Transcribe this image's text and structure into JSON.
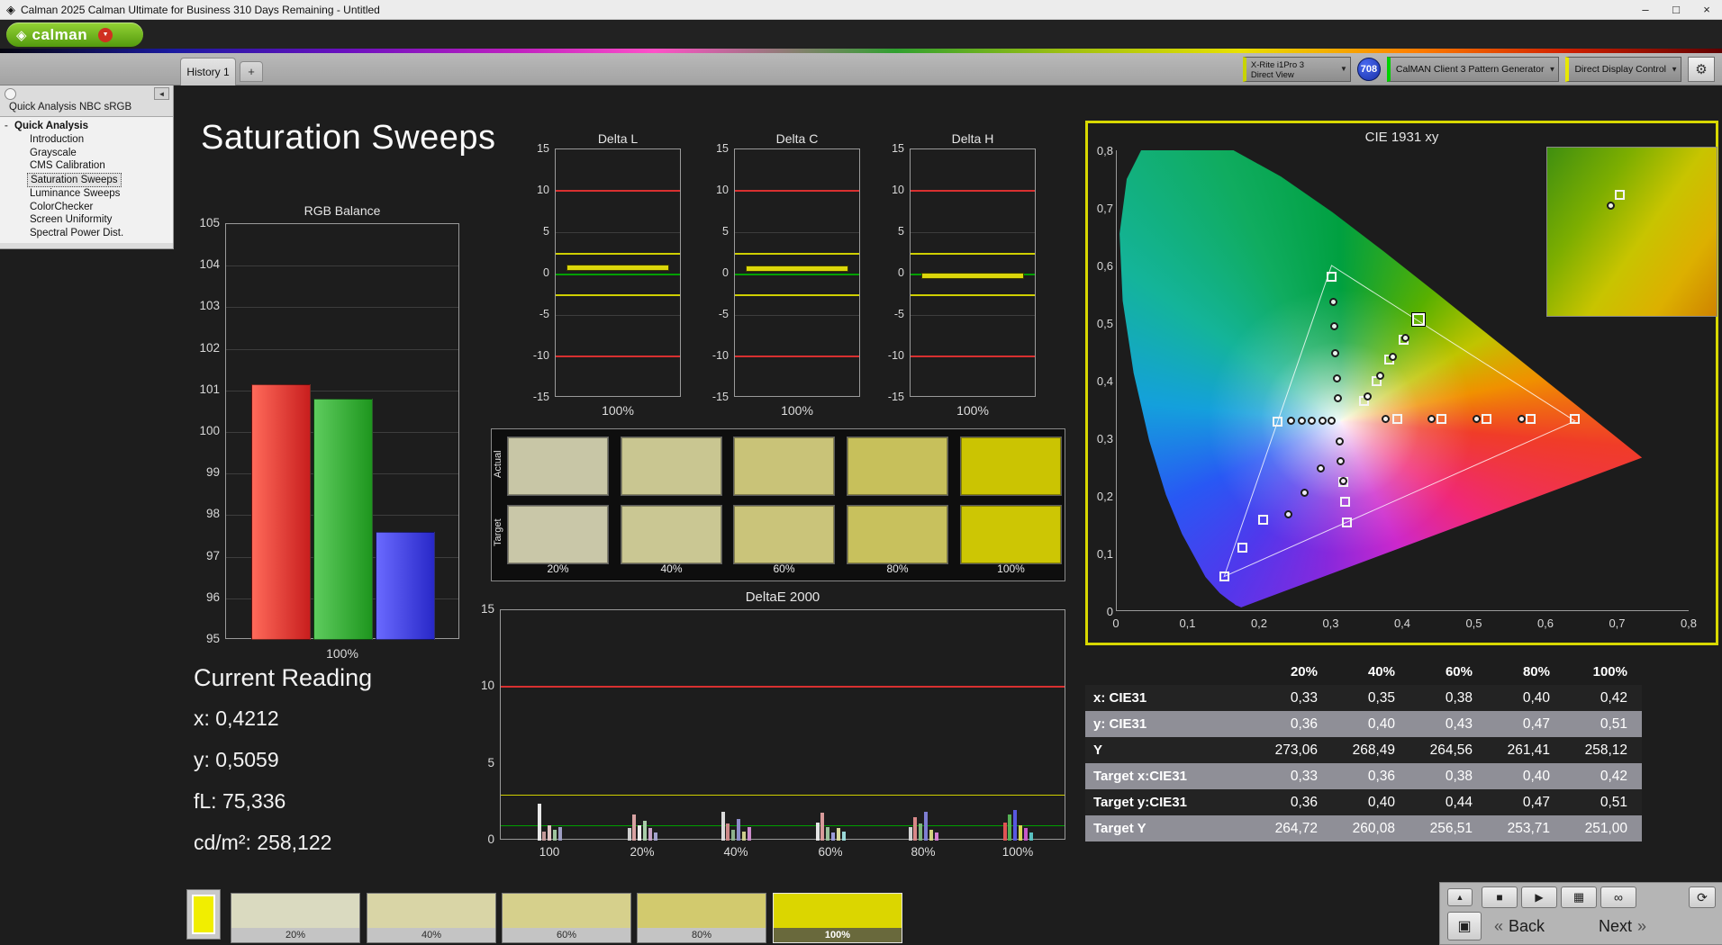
{
  "title_bar": {
    "title": "Calman 2025 Calman Ultimate for Business 310 Days Remaining  - Untitled"
  },
  "window": {
    "minimize": "–",
    "maximize": "□",
    "close": "×"
  },
  "logo": {
    "brand": "calman"
  },
  "tabs": {
    "history": "History 1",
    "add": "+"
  },
  "devices": {
    "meter": {
      "line1": "X-Rite i1Pro 3",
      "line2": "Direct View",
      "accent": "#c8d400"
    },
    "badge": "708",
    "pattern": {
      "label": "CalMAN Client 3 Pattern Generator",
      "accent": "#00d000"
    },
    "display": {
      "label": "Direct Display Control",
      "accent": "#e8e800"
    }
  },
  "icons": {
    "app": "◈",
    "brand_diamond": "◈",
    "caret_down": "▼",
    "gear": "⚙",
    "collapse_left": "◄",
    "eject": "▲",
    "stop": "■",
    "play": "▶",
    "save": "▦",
    "loop": "∞",
    "refresh": "⟳",
    "pattern_window": "▣"
  },
  "sidebar": {
    "header": "Quick Analysis NBC sRGB",
    "root": "Quick Analysis",
    "items": [
      {
        "label": "Introduction"
      },
      {
        "label": "Grayscale"
      },
      {
        "label": "CMS Calibration"
      },
      {
        "label": "Saturation Sweeps",
        "selected": true
      },
      {
        "label": "Luminance Sweeps"
      },
      {
        "label": "ColorChecker"
      },
      {
        "label": "Screen Uniformity"
      },
      {
        "label": "Spectral Power Dist."
      }
    ]
  },
  "page": {
    "title": "Saturation Sweeps"
  },
  "current_reading": {
    "heading": "Current Reading",
    "x": "x: 0,4212",
    "y": "y: 0,5059",
    "fl": "fL: 75,336",
    "cdm2": "cd/m²: 258,122"
  },
  "chart_data": [
    {
      "id": "rgb-balance",
      "type": "bar",
      "title": "RGB Balance",
      "categories": [
        "Red",
        "Green",
        "Blue"
      ],
      "values": [
        101.15,
        100.8,
        97.6
      ],
      "colors": [
        [
          "#ff6a5a",
          "#c81e1e"
        ],
        [
          "#5ecc5e",
          "#1e961e"
        ],
        [
          "#6a6aff",
          "#2828c8"
        ]
      ],
      "ylim": [
        95,
        105
      ],
      "ytick_step": 1,
      "xlabel": "100%",
      "grid": true
    },
    {
      "id": "delta-l",
      "type": "tolerance-bar",
      "title": "Delta L",
      "value": 0.6,
      "ylim": [
        -15,
        15
      ],
      "yticks": [
        15,
        10,
        5,
        0,
        -5,
        -10,
        -15
      ],
      "red_lines": [
        10,
        -10
      ],
      "yellow_lines": [
        2.5,
        -2.5
      ],
      "green_lines": [
        0
      ],
      "bar_color": "#dcd70a",
      "xlabel": "100%"
    },
    {
      "id": "delta-c",
      "type": "tolerance-bar",
      "title": "Delta C",
      "value": 0.5,
      "ylim": [
        -15,
        15
      ],
      "yticks": [
        15,
        10,
        5,
        0,
        -5,
        -10,
        -15
      ],
      "red_lines": [
        10,
        -10
      ],
      "yellow_lines": [
        2.5,
        -2.5
      ],
      "green_lines": [
        0
      ],
      "bar_color": "#dcd70a",
      "xlabel": "100%"
    },
    {
      "id": "delta-h",
      "type": "tolerance-bar",
      "title": "Delta H",
      "value": -0.3,
      "ylim": [
        -15,
        15
      ],
      "yticks": [
        15,
        10,
        5,
        0,
        -5,
        -10,
        -15
      ],
      "red_lines": [
        10,
        -10
      ],
      "yellow_lines": [
        2.5,
        -2.5
      ],
      "green_lines": [
        0
      ],
      "bar_color": "#dcd70a",
      "xlabel": "100%"
    },
    {
      "id": "deltae-2000",
      "type": "grouped-bar",
      "title": "DeltaE 2000",
      "ylim": [
        0,
        15
      ],
      "yticks": [
        0,
        5,
        10,
        15
      ],
      "red_lines": [
        10
      ],
      "yellow_lines": [
        3
      ],
      "green_lines": [
        1
      ],
      "group_labels": [
        "100",
        "20%",
        "40%",
        "60%",
        "80%",
        "100%"
      ],
      "group_x": [
        55,
        158,
        262,
        367,
        470,
        575
      ],
      "groups": [
        [
          [
            "#e9e9e9",
            2.4
          ],
          [
            "#c49a9a",
            0.6
          ],
          [
            "#e0c4c4",
            1.0
          ],
          [
            "#9ec49e",
            0.7
          ],
          [
            "#9e9ec4",
            0.9
          ]
        ],
        [
          [
            "#cfcfcf",
            0.8
          ],
          [
            "#d8a2a2",
            1.7
          ],
          [
            "#ececec",
            1.0
          ],
          [
            "#a8cca8",
            1.3
          ],
          [
            "#c6a2c6",
            0.8
          ],
          [
            "#a2a2cc",
            0.5
          ]
        ],
        [
          [
            "#dadada",
            1.9
          ],
          [
            "#cc8888",
            1.1
          ],
          [
            "#8cb08c",
            0.7
          ],
          [
            "#8c8cc8",
            1.4
          ],
          [
            "#cccc8c",
            0.6
          ],
          [
            "#cc8ccc",
            0.9
          ]
        ],
        [
          [
            "#e4e4e4",
            1.2
          ],
          [
            "#d89a9a",
            1.8
          ],
          [
            "#9ac09a",
            0.9
          ],
          [
            "#9a9ad8",
            0.5
          ],
          [
            "#d8d89a",
            0.8
          ],
          [
            "#9ad8d8",
            0.6
          ]
        ],
        [
          [
            "#d2d2d2",
            0.9
          ],
          [
            "#d88888",
            1.5
          ],
          [
            "#7eb47e",
            1.1
          ],
          [
            "#7e7ed2",
            1.9
          ],
          [
            "#d2d27e",
            0.7
          ],
          [
            "#d27ed2",
            0.5
          ]
        ],
        [
          [
            "#e05454",
            1.2
          ],
          [
            "#54b054",
            1.7
          ],
          [
            "#5858e0",
            2.0
          ],
          [
            "#d8d854",
            1.0
          ],
          [
            "#c858c8",
            0.8
          ],
          [
            "#58c0c0",
            0.5
          ]
        ]
      ]
    },
    {
      "id": "cie-1931",
      "type": "scatter",
      "title": "CIE 1931 xy",
      "xlim": [
        0,
        0.8
      ],
      "ylim": [
        0,
        0.8
      ],
      "xticks": [
        "0",
        "0,1",
        "0,2",
        "0,3",
        "0,4",
        "0,5",
        "0,6",
        "0,7",
        "0,8"
      ],
      "yticks": [
        "0",
        "0,1",
        "0,2",
        "0,3",
        "0,4",
        "0,5",
        "0,6",
        "0,7",
        "0,8"
      ],
      "srgb_triangle": [
        [
          0.64,
          0.33
        ],
        [
          0.3,
          0.6
        ],
        [
          0.15,
          0.06
        ]
      ],
      "white_point": [
        0.3127,
        0.329
      ],
      "targets": [
        [
          0.392,
          0.333
        ],
        [
          0.454,
          0.333
        ],
        [
          0.516,
          0.333
        ],
        [
          0.578,
          0.333
        ],
        [
          0.64,
          0.333
        ],
        [
          0.3,
          0.581
        ],
        [
          0.345,
          0.365
        ],
        [
          0.363,
          0.4
        ],
        [
          0.381,
          0.436
        ],
        [
          0.4,
          0.471
        ],
        [
          0.225,
          0.329
        ],
        [
          0.204,
          0.159
        ],
        [
          0.175,
          0.11
        ],
        [
          0.15,
          0.06
        ],
        [
          0.316,
          0.225
        ],
        [
          0.319,
          0.19
        ],
        [
          0.321,
          0.154
        ]
      ],
      "measurements": [
        [
          0.303,
          0.537
        ],
        [
          0.304,
          0.494
        ],
        [
          0.305,
          0.448
        ],
        [
          0.307,
          0.404
        ],
        [
          0.309,
          0.37
        ],
        [
          0.376,
          0.334
        ],
        [
          0.44,
          0.334
        ],
        [
          0.502,
          0.334
        ],
        [
          0.565,
          0.334
        ],
        [
          0.243,
          0.33
        ],
        [
          0.258,
          0.33
        ],
        [
          0.272,
          0.33
        ],
        [
          0.287,
          0.33
        ],
        [
          0.3,
          0.33
        ],
        [
          0.35,
          0.372
        ],
        [
          0.368,
          0.408
        ],
        [
          0.386,
          0.442
        ],
        [
          0.403,
          0.474
        ],
        [
          0.311,
          0.295
        ],
        [
          0.313,
          0.26
        ],
        [
          0.316,
          0.226
        ],
        [
          0.285,
          0.247
        ],
        [
          0.262,
          0.205
        ],
        [
          0.24,
          0.168
        ]
      ],
      "current": [
        0.4212,
        0.5059
      ]
    }
  ],
  "patch_panel": {
    "row_labels": [
      "Actual",
      "Target"
    ],
    "col_labels": [
      "20%",
      "40%",
      "60%",
      "80%",
      "100%"
    ],
    "actual": [
      "#c8c6a6",
      "#c9c691",
      "#c9c378",
      "#c7c05b",
      "#cbc402"
    ],
    "target": [
      "#c9c7a8",
      "#cac793",
      "#cac47a",
      "#c8c15d",
      "#cdc604"
    ]
  },
  "table": {
    "headers": [
      "",
      "20%",
      "40%",
      "60%",
      "80%",
      "100%"
    ],
    "rows": [
      {
        "label": "x: CIE31",
        "values": [
          "0,33",
          "0,35",
          "0,38",
          "0,40",
          "0,42"
        ],
        "shade": "dark"
      },
      {
        "label": "y: CIE31",
        "values": [
          "0,36",
          "0,40",
          "0,43",
          "0,47",
          "0,51"
        ],
        "shade": "gray"
      },
      {
        "label": "Y",
        "values": [
          "273,06",
          "268,49",
          "264,56",
          "261,41",
          "258,12"
        ],
        "shade": "dark"
      },
      {
        "label": "Target x:CIE31",
        "values": [
          "0,33",
          "0,36",
          "0,38",
          "0,40",
          "0,42"
        ],
        "shade": "gray"
      },
      {
        "label": "Target y:CIE31",
        "values": [
          "0,36",
          "0,40",
          "0,44",
          "0,47",
          "0,51"
        ],
        "shade": "dark"
      },
      {
        "label": "Target Y",
        "values": [
          "264,72",
          "260,08",
          "256,51",
          "253,71",
          "251,00"
        ],
        "shade": "gray"
      }
    ]
  },
  "bottom_bar": {
    "swatch_color": "#f1ee00",
    "patches": [
      {
        "label": "20%",
        "color": "#dadac0"
      },
      {
        "label": "40%",
        "color": "#d9d5a6"
      },
      {
        "label": "60%",
        "color": "#d6d08c"
      },
      {
        "label": "80%",
        "color": "#d2ca6e"
      },
      {
        "label": "100%",
        "color": "#dbd600",
        "selected": true
      }
    ],
    "back_label": "Back",
    "next_label": "Next",
    "prev_glyph": "«",
    "next_glyph": "»"
  }
}
